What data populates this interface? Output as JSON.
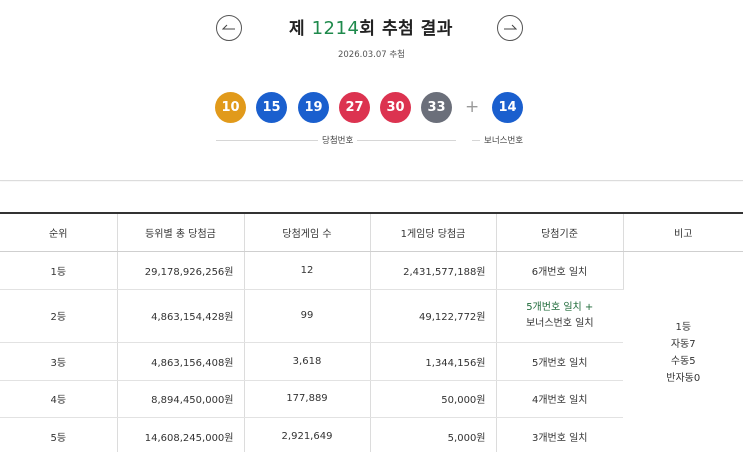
{
  "header": {
    "title_prefix": "제",
    "round": "1214",
    "title_suffix": "회 추첨 결과",
    "date": "2026.03.07 추첨"
  },
  "draw": {
    "numbers": [
      {
        "value": "10",
        "color": "#e19a1b"
      },
      {
        "value": "15",
        "color": "#1a5fce"
      },
      {
        "value": "19",
        "color": "#1a5fce"
      },
      {
        "value": "27",
        "color": "#dc3350"
      },
      {
        "value": "30",
        "color": "#dc3350"
      },
      {
        "value": "33",
        "color": "#6b6f7a"
      }
    ],
    "plus": "+",
    "bonus": {
      "value": "14",
      "color": "#1a5fce"
    },
    "numbers_label": "당첨번호",
    "bonus_label": "보너스번호"
  },
  "table": {
    "headers": [
      "순위",
      "등위별 총 당첨금",
      "당첨게임 수",
      "1게임당 당첨금",
      "당첨기준",
      "비고"
    ],
    "rows": [
      {
        "rank": "1등",
        "total": "29,178,926,256원",
        "games": "12",
        "per_game": "2,431,577,188원",
        "criteria": [
          "6개번호 일치"
        ]
      },
      {
        "rank": "2등",
        "total": "4,863,154,428원",
        "games": "99",
        "per_game": "49,122,772원",
        "criteria": [
          "5개번호 일치 +",
          "보너스번호 일치"
        ]
      },
      {
        "rank": "3등",
        "total": "4,863,156,408원",
        "games": "3,618",
        "per_game": "1,344,156원",
        "criteria": [
          "5개번호 일치"
        ]
      },
      {
        "rank": "4등",
        "total": "8,894,450,000원",
        "games": "177,889",
        "per_game": "50,000원",
        "criteria": [
          "4개번호 일치"
        ]
      },
      {
        "rank": "5등",
        "total": "14,608,245,000원",
        "games": "2,921,649",
        "per_game": "5,000원",
        "criteria": [
          "3개번호 일치"
        ]
      }
    ],
    "note": [
      "1등",
      "자동7",
      "수동5",
      "반자동0"
    ]
  },
  "icons": {
    "prev": "arrow-left-icon",
    "next": "arrow-right-icon"
  }
}
